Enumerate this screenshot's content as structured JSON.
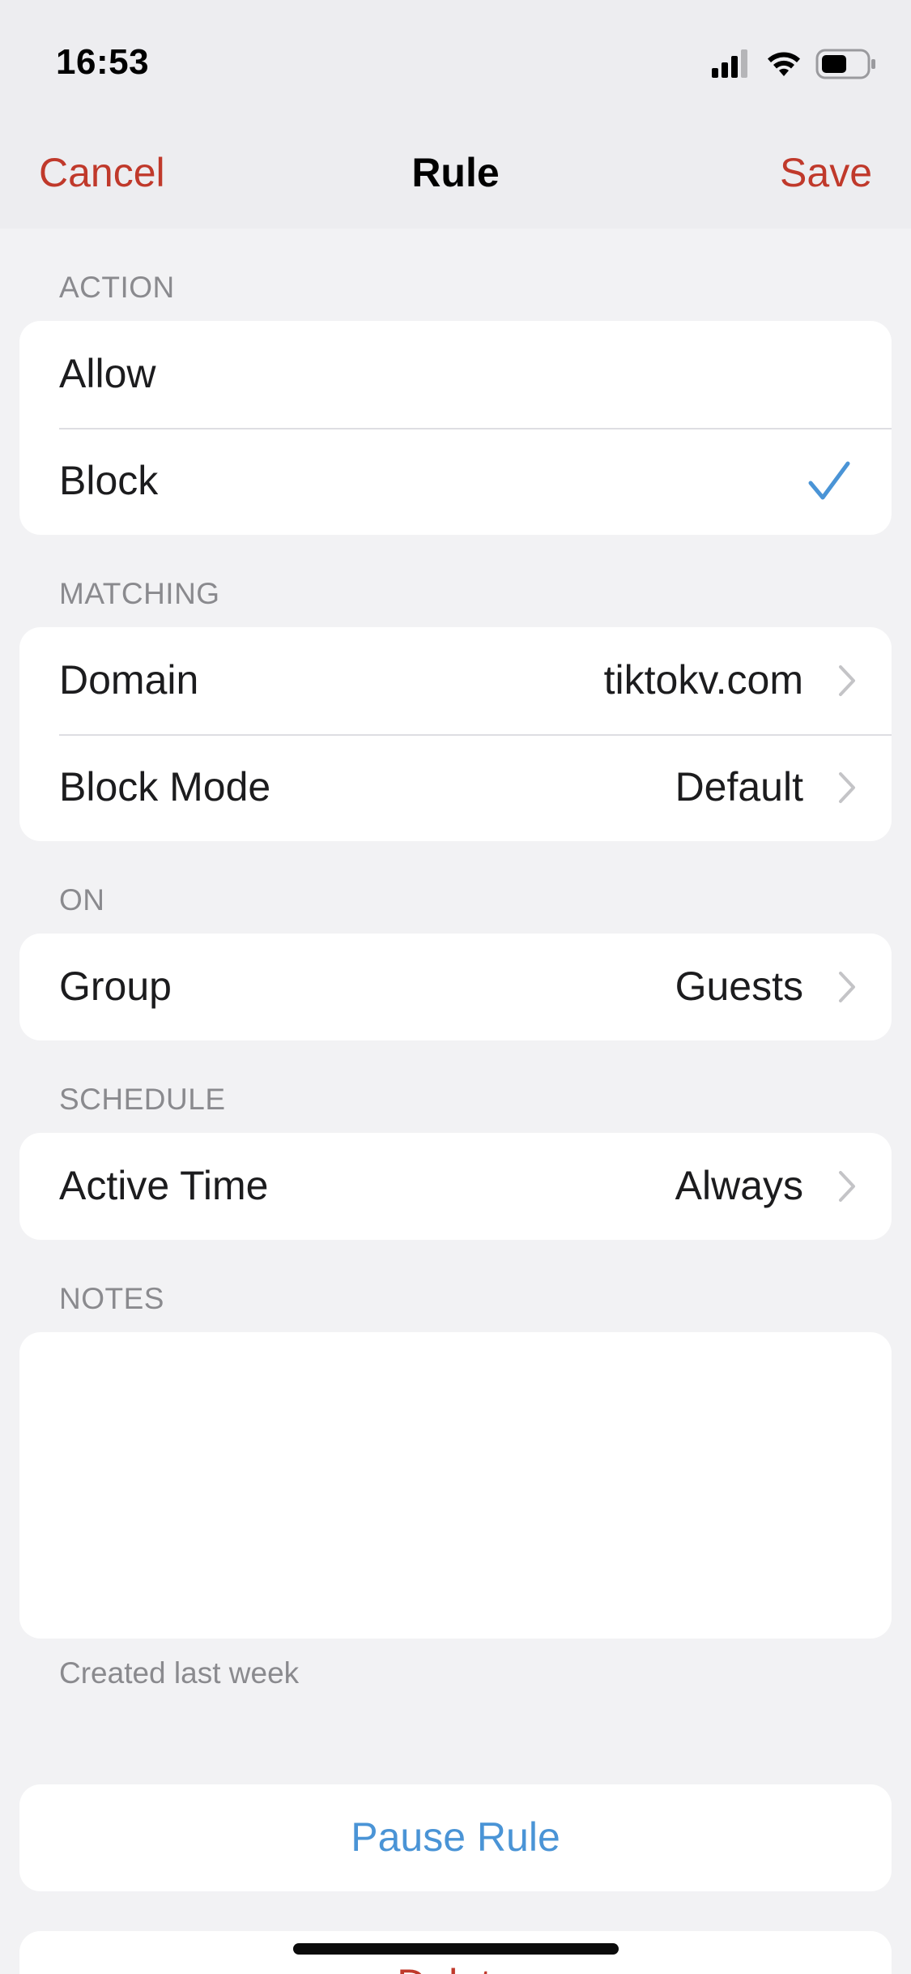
{
  "status_bar": {
    "time": "16:53"
  },
  "nav": {
    "cancel": "Cancel",
    "title": "Rule",
    "save": "Save"
  },
  "colors": {
    "accent_red": "#c0392b",
    "accent_blue": "#4a94d6"
  },
  "action": {
    "header": "ACTION",
    "options": [
      {
        "label": "Allow",
        "selected": false
      },
      {
        "label": "Block",
        "selected": true
      }
    ]
  },
  "matching": {
    "header": "MATCHING",
    "rows": [
      {
        "label": "Domain",
        "value": "tiktokv.com"
      },
      {
        "label": "Block Mode",
        "value": "Default"
      }
    ]
  },
  "on": {
    "header": "ON",
    "rows": [
      {
        "label": "Group",
        "value": "Guests"
      }
    ]
  },
  "schedule": {
    "header": "SCHEDULE",
    "rows": [
      {
        "label": "Active Time",
        "value": "Always"
      }
    ]
  },
  "notes": {
    "header": "NOTES",
    "value": "",
    "footer": "Created last week"
  },
  "buttons": {
    "pause": "Pause Rule",
    "delete": "Delete"
  }
}
